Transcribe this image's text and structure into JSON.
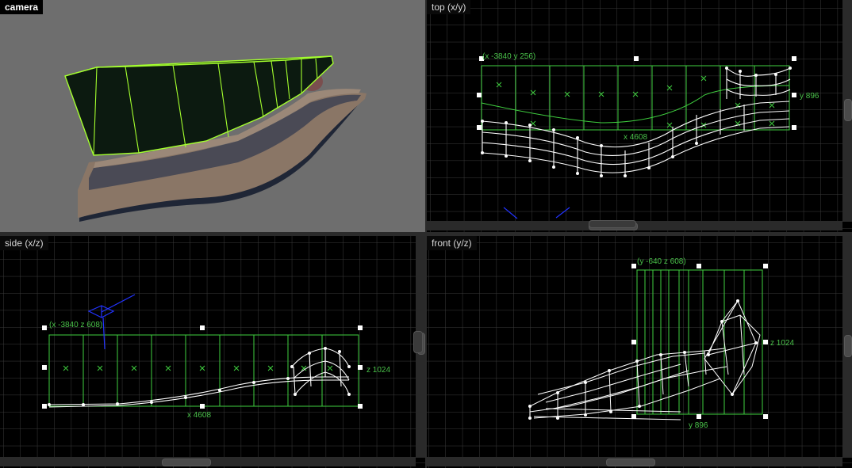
{
  "viewports": {
    "camera": {
      "title": "camera"
    },
    "top": {
      "title": "top (x/y)",
      "origin_label": "(x -3840 y 256)",
      "width_label": "x 4608",
      "height_label": "y 896"
    },
    "side": {
      "title": "side (x/z)",
      "origin_label": "(x -3840 z 608)",
      "width_label": "x 4608",
      "height_label": "z 1024"
    },
    "front": {
      "title": "front (y/z)",
      "origin_label": "(y -640 z 608)",
      "width_label": "y 896",
      "height_label": "z 1024"
    }
  },
  "colors": {
    "grid_bg": "#000000",
    "grid_line": "#3c3c3c",
    "selection": "#3fcf3f",
    "wireframe": "#ffffff",
    "camera_bg": "#6e6e6e",
    "camera_marker": "#2233ff"
  },
  "icons": [
    "camera-marker-icon",
    "resize-handle-icon"
  ]
}
